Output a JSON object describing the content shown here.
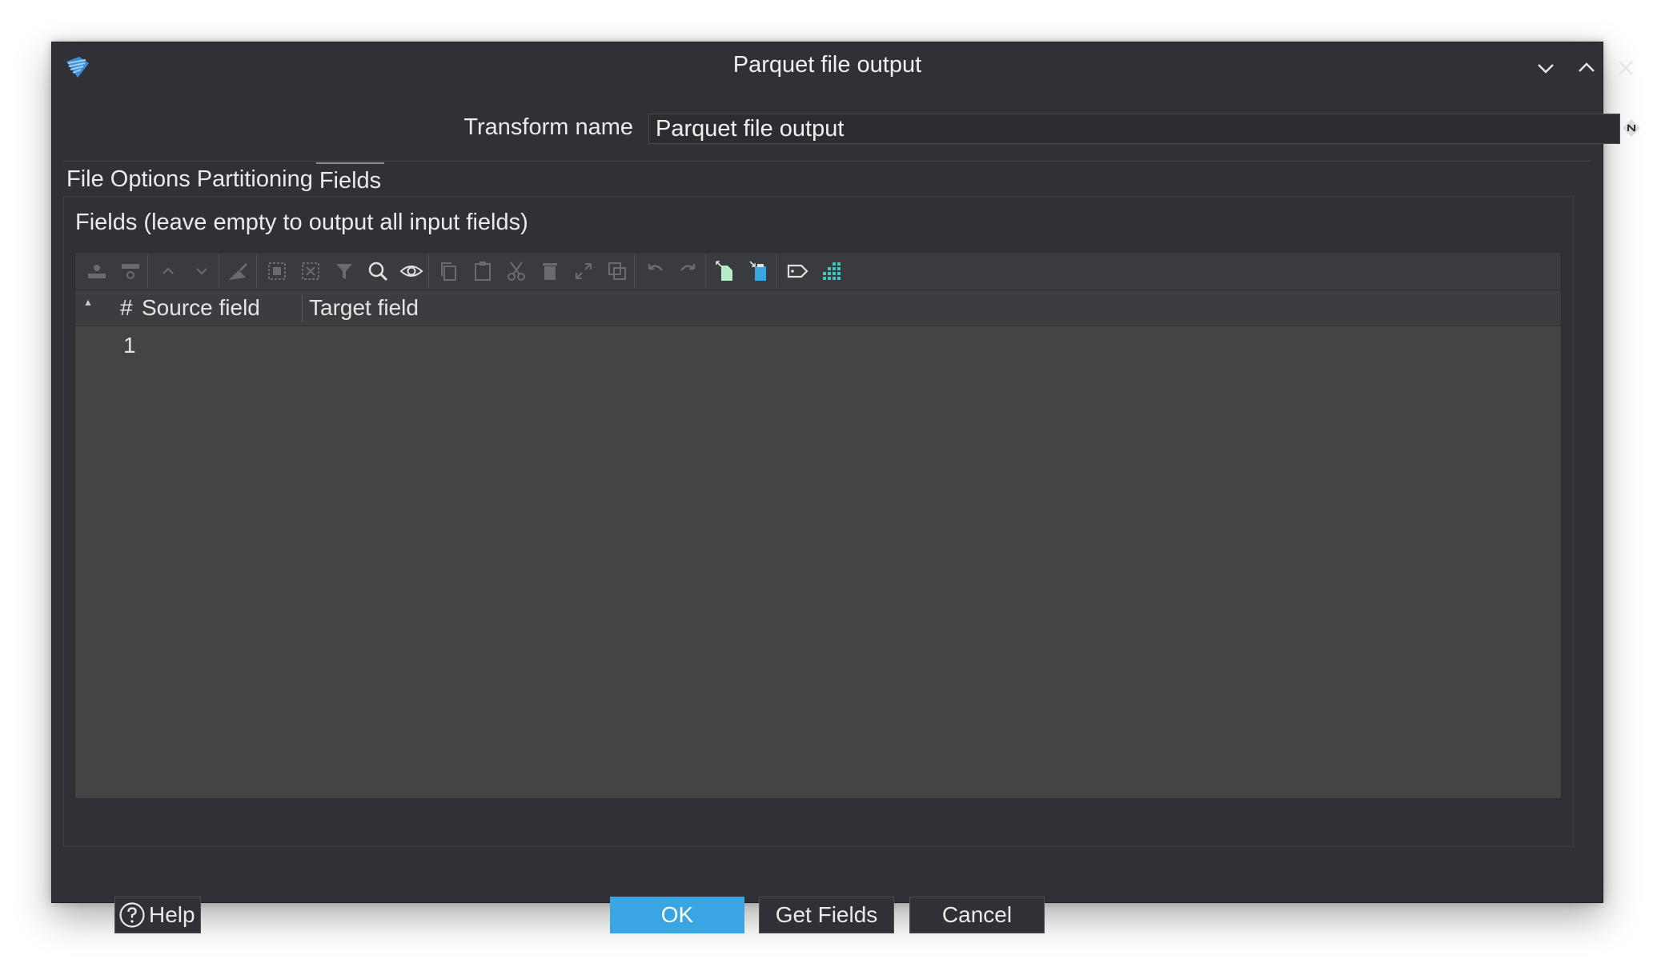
{
  "window": {
    "title": "Parquet file output",
    "buttons": [
      "minimize",
      "maximize",
      "close"
    ]
  },
  "transform": {
    "label": "Transform name",
    "value": "Parquet file output"
  },
  "tabs": [
    {
      "label": "File Options",
      "active": false
    },
    {
      "label": "Partitioning",
      "active": false
    },
    {
      "label": "Fields",
      "active": true
    }
  ],
  "fields_section": {
    "label": "Fields (leave empty to output all input fields)",
    "toolbar_icons": [
      "insert-row-icon",
      "delete-row-icon",
      "move-up-icon",
      "move-down-icon",
      "clear-icon",
      "select-all-icon",
      "deselect-icon",
      "filter-icon",
      "search-icon",
      "preview-icon",
      "copy-icon",
      "paste-icon",
      "cut-icon",
      "delete-icon",
      "expand-icon",
      "duplicate-icon",
      "undo-icon",
      "redo-icon",
      "export-icon",
      "import-icon",
      "label-icon",
      "grid-icon"
    ],
    "columns": {
      "sort_indicator": "▴",
      "number": "#",
      "source": "Source field",
      "target": "Target field"
    },
    "rows": [
      {
        "number": "1",
        "source": "",
        "target": ""
      }
    ]
  },
  "footer": {
    "help": "Help",
    "ok": "OK",
    "get_fields": "Get Fields",
    "cancel": "Cancel"
  },
  "colors": {
    "accent": "#3aa5e3",
    "background": "#2f3136",
    "table_bg": "#444444"
  }
}
